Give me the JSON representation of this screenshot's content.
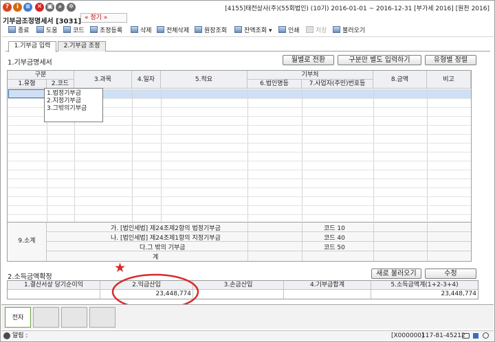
{
  "window": {
    "title_right": "[4155]태전상사(주)(55회법인) (10기) 2016-01-01 ~ 2016-12-31 [부가세 2016] [원천 2016]",
    "title": "기부금조정명세서 [3031]",
    "badge": "« 정기 »"
  },
  "topbar_icons": [
    {
      "name": "help-icon",
      "glyph": "?",
      "color": "#d9421c"
    },
    {
      "name": "info-icon",
      "glyph": "i",
      "color": "#d06a12"
    },
    {
      "name": "chat-icon",
      "glyph": "≡",
      "color": "#3f7bd2"
    },
    {
      "name": "close-icon",
      "glyph": "✕",
      "color": "#d82424"
    },
    {
      "name": "print-icon",
      "glyph": "▣",
      "color": "#6a6a6a"
    },
    {
      "name": "search-icon",
      "glyph": "⌕",
      "color": "#6a6a6a"
    },
    {
      "name": "gear-icon",
      "glyph": "✲",
      "color": "#6a6a6a"
    }
  ],
  "toolbar": [
    {
      "label": "종료",
      "disabled": false
    },
    {
      "label": "도움",
      "disabled": false
    },
    {
      "label": "코드",
      "disabled": false
    },
    {
      "label": "조정등록",
      "disabled": false
    },
    {
      "label": "삭제",
      "disabled": false
    },
    {
      "label": "전체삭제",
      "disabled": false
    },
    {
      "label": "원장조회",
      "disabled": false
    },
    {
      "label": "잔액조회 ▾",
      "disabled": false
    },
    {
      "label": "인쇄",
      "disabled": false
    },
    {
      "label": "저장",
      "disabled": true
    },
    {
      "label": "불러오기",
      "disabled": false
    }
  ],
  "tabs": [
    "1.기부금 입력",
    "2.기부금 조정"
  ],
  "section1_title": "1.기부금명세서",
  "buttons": {
    "monthly": "월별로 전환",
    "by_type": "구분만 별도 입력하기",
    "sort": "유형별 정렬",
    "reload": "새로 불러오기",
    "edit": "수정"
  },
  "grid": {
    "header_group_gubun": "구분",
    "header_group_donor": "기부처",
    "columns": [
      "1.유형",
      "2.코드",
      "3.과목",
      "4.일자",
      "5.적요",
      "6.법인명등",
      "7.사업자(주민)번호등",
      "8.금액",
      "비고"
    ]
  },
  "dropdown_options": [
    "1.법정기부금",
    "2.지정기부금",
    "3.그밖의기부금"
  ],
  "subtotal": {
    "label": "9.소계",
    "rows": [
      {
        "desc": "가. [법인세법] 제24조제2항의 법정기부금",
        "code": "코드 10"
      },
      {
        "desc": "나. [법인세법] 제24조제1항의 지정기부금",
        "code": "코드 40"
      },
      {
        "desc": "다.그 밖의 기부금",
        "code": "코드 50"
      },
      {
        "desc": "계",
        "code": ""
      }
    ]
  },
  "section2_title": "2.소득금액확정",
  "income": {
    "headers": [
      "1.결산서상 당기순이익",
      "2.익금산입",
      "3.손금산입",
      "4.기부금합계",
      "5.소득금액계(1+2-3+4)"
    ],
    "values": [
      "",
      "23,448,774",
      "",
      "",
      "23,448,774"
    ]
  },
  "annotation": {
    "star": "★",
    "color": "#d62a2a"
  },
  "bottom_tab": "전자",
  "status": {
    "left": "알림 :",
    "code": "[X000000]",
    "bizno": "117-81-45212"
  }
}
